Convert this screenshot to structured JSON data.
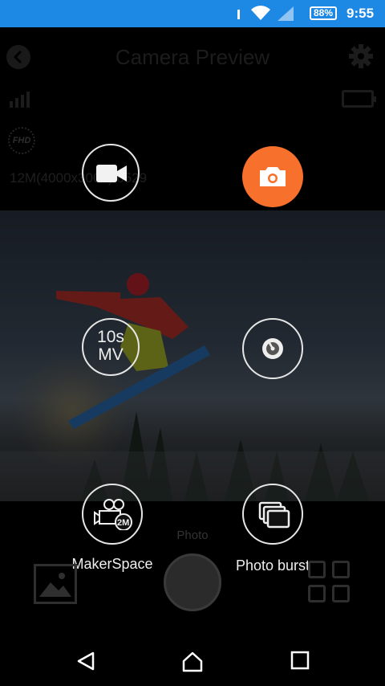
{
  "status_bar": {
    "battery": "88%",
    "time": "9:55"
  },
  "header": {
    "title": "Camera Preview"
  },
  "camera_info": {
    "resolution": "12M(4000x3000)/6529",
    "video_quality": "FHD"
  },
  "modes": {
    "video": {
      "name": "video-mode"
    },
    "photo": {
      "name": "photo-mode"
    },
    "music_video": {
      "label": "10s\nMV"
    },
    "timelapse": {
      "name": "timelapse-mode"
    },
    "makerspace": {
      "label": "MakerSpace",
      "badge": "2M"
    },
    "photo_burst": {
      "label": "Photo burst"
    }
  },
  "bottom": {
    "hint": "Photo"
  },
  "colors": {
    "accent": "#f7712c",
    "statusbar": "#1e88e5"
  }
}
